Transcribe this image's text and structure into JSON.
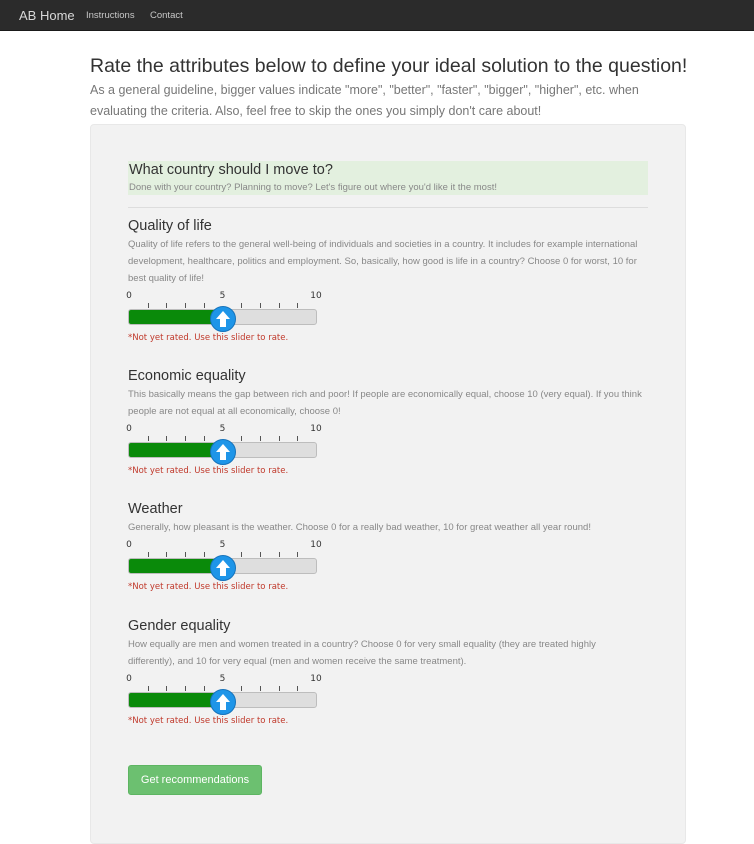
{
  "navbar": {
    "brand": "AB Home",
    "links": [
      "Instructions",
      "Contact"
    ]
  },
  "header": {
    "title": "Rate the attributes below to define your ideal solution to the question!",
    "intro": "As a general guideline, bigger values indicate \"more\", \"better\", \"faster\", \"bigger\", \"higher\", etc. when evaluating the criteria. Also, feel free to skip the ones you simply don't care about!"
  },
  "question": {
    "title": "What country should I move to?",
    "subtitle": "Done with your country? Planning to move? Let's figure out where you'd like it the most!"
  },
  "slider_scale": {
    "min_label": "0",
    "mid_label": "5",
    "max_label": "10",
    "min": 0,
    "max": 10
  },
  "attributes": [
    {
      "title": "Quality of life",
      "description": "Quality of life refers to the general well-being of individuals and societies in a country. It includes for example international development, healthcare, politics and employment. So, basically, how good is life in a country? Choose 0 for worst, 10 for best quality of life!",
      "value": 5,
      "status": "*Not yet rated. Use this slider to rate."
    },
    {
      "title": "Economic equality",
      "description": "This basically means the gap between rich and poor! If people are economically equal, choose 10 (very equal). If you think people are not equal at all economically, choose 0!",
      "value": 5,
      "status": "*Not yet rated. Use this slider to rate."
    },
    {
      "title": "Weather",
      "description": "Generally, how pleasant is the weather. Choose 0 for a really bad weather, 10 for great weather all year round!",
      "value": 5,
      "status": "*Not yet rated. Use this slider to rate."
    },
    {
      "title": "Gender equality",
      "description": "How equally are men and women treated in a country? Choose 0 for very small equality (they are treated highly differently), and 10 for very equal (men and women receive the same treatment).",
      "value": 5,
      "status": "*Not yet rated. Use this slider to rate."
    }
  ],
  "submit_label": "Get recommendations",
  "colors": {
    "fill": "#0a8a0a",
    "handle": "#1e95e8",
    "warning": "#c0392b",
    "button": "#6cc070",
    "question_bg": "#e3f0df"
  }
}
